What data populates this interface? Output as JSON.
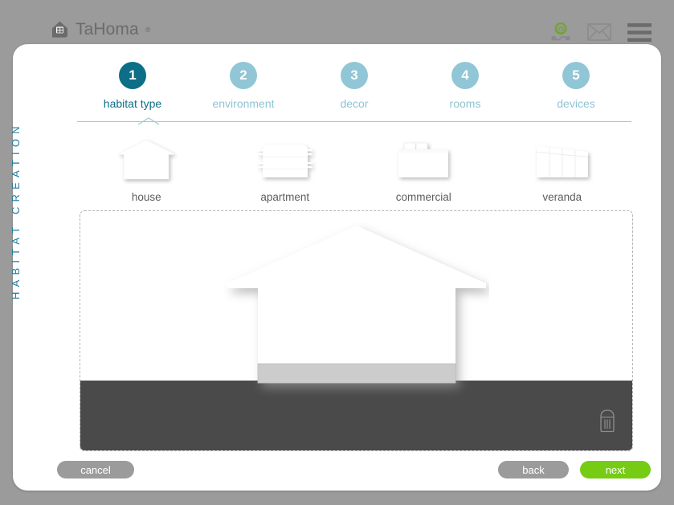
{
  "header": {
    "brand_name": "TaHoma",
    "brand_registered": "®",
    "brand_icon": "house-logo-icon",
    "icons": [
      {
        "name": "at-connection-icon",
        "label": "@"
      },
      {
        "name": "mail-envelope-icon",
        "label": "envelope"
      },
      {
        "name": "hamburger-menu-icon",
        "label": "menu"
      }
    ]
  },
  "side_title": "HABITAT CREATION",
  "steps": [
    {
      "number": "1",
      "label": "habitat type",
      "active": true
    },
    {
      "number": "2",
      "label": "environment",
      "active": false
    },
    {
      "number": "3",
      "label": "decor",
      "active": false
    },
    {
      "number": "4",
      "label": "rooms",
      "active": false
    },
    {
      "number": "5",
      "label": "devices",
      "active": false
    }
  ],
  "habitat_types": [
    {
      "label": "house",
      "icon": "house-thumb-icon"
    },
    {
      "label": "apartment",
      "icon": "apartment-thumb-icon"
    },
    {
      "label": "commercial",
      "icon": "commercial-thumb-icon"
    },
    {
      "label": "veranda",
      "icon": "veranda-thumb-icon"
    }
  ],
  "canvas": {
    "selected_shape": "house",
    "trash_icon": "trash-bin-icon"
  },
  "footer": {
    "cancel_label": "cancel",
    "back_label": "back",
    "next_label": "next"
  },
  "colors": {
    "accent_active": "#0d6e87",
    "accent_inactive": "#91c6d6",
    "next_green": "#76cc14",
    "button_gray": "#9b9b9b",
    "ground_dark": "#4a4a4a",
    "page_background": "#9b9b9b"
  }
}
